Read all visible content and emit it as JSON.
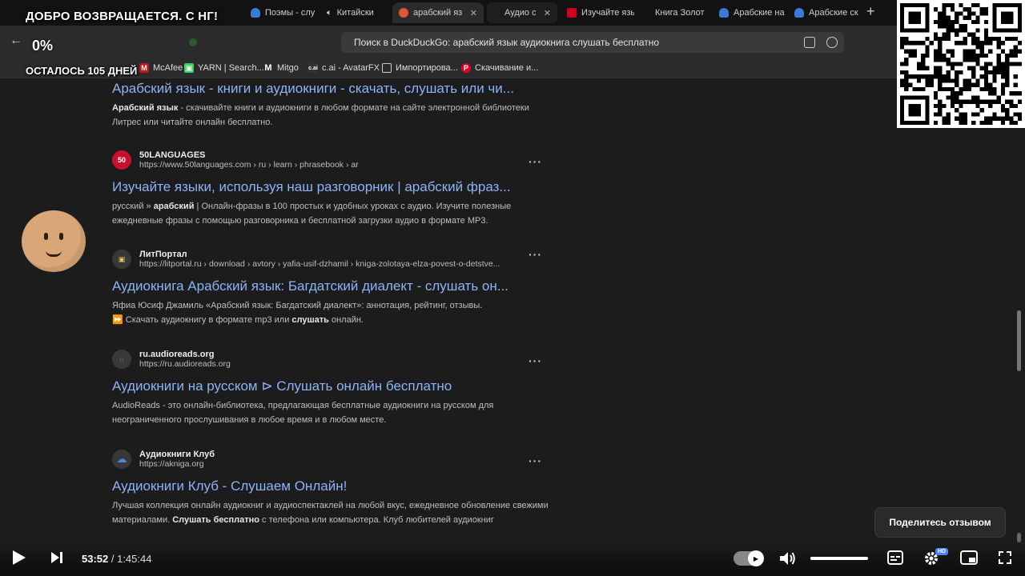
{
  "overlay": {
    "welcome": "ДОБРО ВОЗВРАЩАЕТСЯ. С НГ!",
    "percent": "0%",
    "days_left": "ОСТАЛОСЬ 105 ДНЕЙ"
  },
  "tabs": [
    {
      "label": "Поэмы - слу",
      "icon": "cloud-icon",
      "color": "#3a7bd5"
    },
    {
      "label": "Китайски",
      "icon": "speaker-icon",
      "color": "#3a7bd5"
    },
    {
      "label": "арабский язы",
      "icon": "duckduckgo-icon",
      "color": "#de5833",
      "active": true
    },
    {
      "label": "Аудио ск",
      "icon": "generic-icon",
      "color": "#555"
    },
    {
      "label": "Изучайте язы",
      "icon": "red-icon",
      "color": "#d0021b"
    },
    {
      "label": "Книга Золот",
      "icon": "generic-icon",
      "color": "#555"
    },
    {
      "label": "Арабские на",
      "icon": "cloud-icon",
      "color": "#3a7bd5"
    },
    {
      "label": "Арабские ск",
      "icon": "cloud-icon",
      "color": "#3a7bd5"
    }
  ],
  "address_bar": {
    "text": "Поиск в DuckDuckGo: арабский язык аудиокнига слушать бесплатно"
  },
  "bookmarks": [
    {
      "label": "McAfee",
      "icon": "mcafee-icon",
      "color": "#c01818"
    },
    {
      "label": "YARN | Search...",
      "icon": "yarn-icon",
      "color": "#3ecf5e"
    },
    {
      "label": "Mitgo",
      "icon": "mitgo-icon",
      "color": "#222"
    },
    {
      "label": "c.ai - AvatarFX",
      "icon": "cai-icon",
      "color": "#333"
    },
    {
      "label": "Импортирова...",
      "icon": "folder-icon",
      "color": "#2b2b2b"
    },
    {
      "label": "Скачивание и...",
      "icon": "pinterest-icon",
      "color": "#e60023"
    }
  ],
  "results": [
    {
      "title": "Арабский язык - книги и аудиокниги - скачать, слушать или чи...",
      "snippet_html": "<b>Арабский язык</b> - скачивайте книги и аудиокниги в любом формате на сайте электронной библиотеки Литрес или читайте онлайн бесплатно."
    },
    {
      "name": "50LANGUAGES",
      "url": "https://www.50languages.com › ru › learn › phrasebook › ar",
      "icon_text": "50",
      "icon_color": "#c8102e",
      "title": "Изучайте языки, используя наш разговорник | арабский фраз...",
      "snippet_html": "русский » <b>арабский</b> | Онлайн-фразы в 100 простых и удобных уроках с аудио. Изучите полезные ежедневные фразы с помощью разговорника и бесплатной загрузки аудио в формате MP3."
    },
    {
      "name": "ЛитПортал",
      "url": "https://litportal.ru › download › avtory › yafia-usif-dzhamil › kniga-zolotaya-elza-povest-o-detstve...",
      "icon_text": "▣",
      "icon_color": "#e0c060",
      "title": "Аудиокнига Арабский язык: Багдатский диалект - слушать он...",
      "snippet_html": "Яфиа Юсиф Джамиль «Арабский язык: Багдатский диалект»: аннотация, рейтинг, отзывы.<br>⏩ Скачать аудиокнигу в формате mp3 или <b>слушать</b> онлайн."
    },
    {
      "name": "ru.audioreads.org",
      "url": "https://ru.audioreads.org",
      "icon_text": "🎧",
      "icon_color": "#4a8bd8",
      "title": "Аудиокниги на русском ⊳ Слушать онлайн бесплатно",
      "snippet_html": "AudioReads - это онлайн-библиотека, предлагающая бесплатные аудиокниги на русском для неограниченного прослушивания в любое время и в любом месте."
    },
    {
      "name": "Аудиокниги Клуб",
      "url": "https://akniga.org",
      "icon_text": "☁",
      "icon_color": "#4a8bd8",
      "title": "Аудиокниги Клуб - Слушаем Онлайн!",
      "snippet_html": "Лучшая коллекция онлайн аудиокниг и аудиоспектаклей на любой вкус, ежедневное обновление свежими материалами. <b>Слушать бесплатно</b> с телефона или компьютера. Клуб любителей аудиокниг"
    }
  ],
  "feedback_label": "Поделитесь отзывом",
  "player": {
    "current": "53:52",
    "separator": " / ",
    "duration": "1:45:44",
    "hd_badge": "HD",
    "volume_fraction": 0.85
  }
}
